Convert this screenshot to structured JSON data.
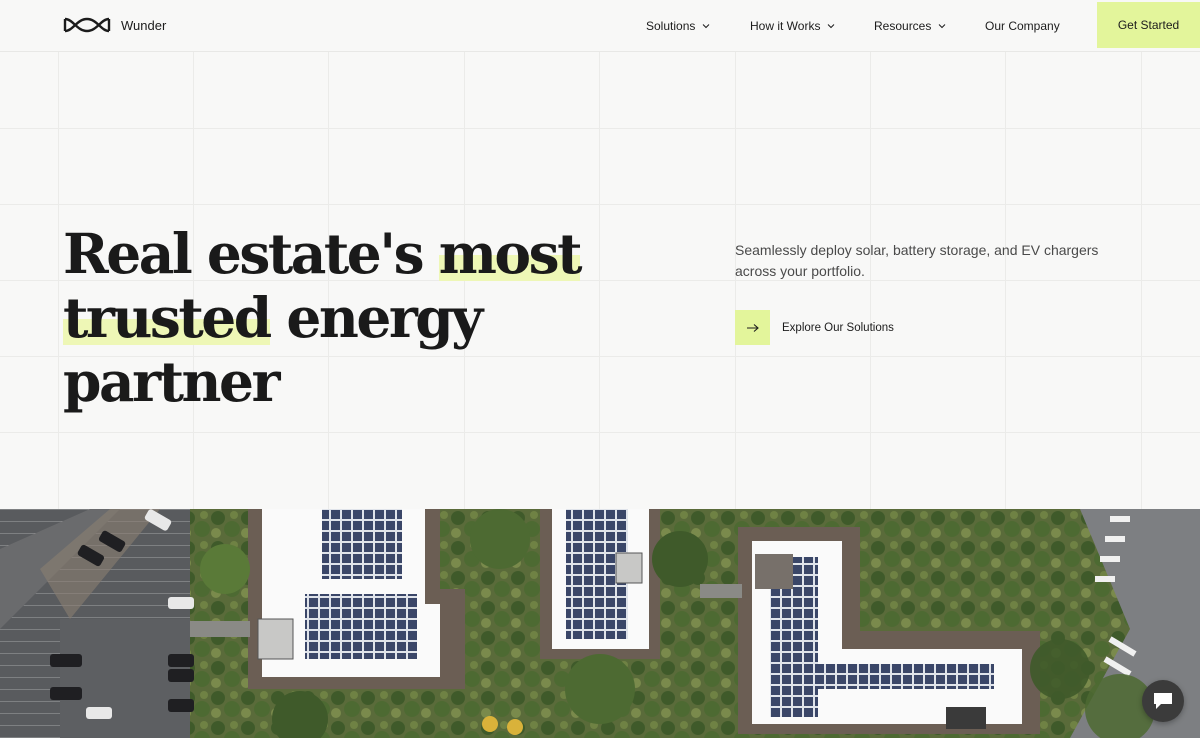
{
  "brand": {
    "name": "Wunder",
    "logo_icon": "infinity-wave-logo"
  },
  "nav": {
    "items": [
      {
        "label": "Solutions",
        "has_dropdown": true
      },
      {
        "label": "How it Works",
        "has_dropdown": true
      },
      {
        "label": "Resources",
        "has_dropdown": true
      },
      {
        "label": "Our Company",
        "has_dropdown": false
      }
    ],
    "cta_label": "Get Started"
  },
  "hero": {
    "headline_part1": "Real estate's ",
    "headline_highlight1": "most",
    "headline_highlight2": "trusted",
    "headline_part2": " energy partner",
    "subtitle": "Seamlessly deploy solar, battery storage, and EV chargers across your portfolio.",
    "explore_label": "Explore Our Solutions",
    "explore_icon": "arrow-right-icon"
  },
  "colors": {
    "accent": "#e3f59b",
    "highlight": "#eef7b6",
    "background": "#f8f8f7",
    "text": "#1c1c1c"
  },
  "photo": {
    "subject": "aerial-view-solar-rooftops",
    "chat_icon": "chat-bubble-icon"
  }
}
